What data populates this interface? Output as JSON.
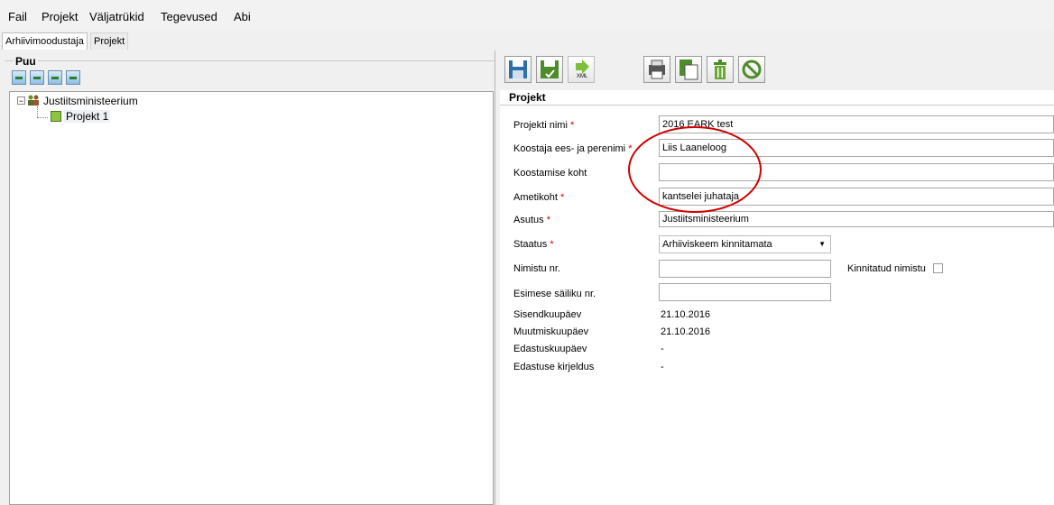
{
  "menu": {
    "items": [
      "Fail",
      "Projekt",
      "Väljatrükid",
      "Tegevused",
      "Abi"
    ]
  },
  "tabs": [
    {
      "label": "Arhiivimoodustaja",
      "active": true
    },
    {
      "label": "Projekt",
      "active": false
    }
  ],
  "left": {
    "title": "Puu",
    "tree": {
      "root": "Justiitsministeerium",
      "child": "Projekt 1"
    }
  },
  "right": {
    "section_title": "Projekt",
    "fields": {
      "projekti_nimi": {
        "label": "Projekti nimi",
        "value": "2016 EARK test"
      },
      "koostaja": {
        "label": "Koostaja ees- ja perenimi",
        "value": "Liis Laaneloog"
      },
      "koostamise_koht": {
        "label": "Koostamise koht",
        "value": ""
      },
      "ametikoht": {
        "label": "Ametikoht",
        "value": "kantselei juhataja"
      },
      "asutus": {
        "label": "Asutus",
        "value": "Justiitsministeerium"
      },
      "staatus": {
        "label": "Staatus",
        "value": "Arhiiviskeem kinnitamata"
      },
      "nimistu": {
        "label": "Nimistu nr.",
        "value": ""
      },
      "kinnitatud": {
        "label": "Kinnitatud nimistu",
        "checked": false
      },
      "esimese": {
        "label": "Esimese säiliku nr.",
        "value": ""
      },
      "sisend": {
        "label": "Sisendkuupäev",
        "value": "21.10.2016"
      },
      "muutmis": {
        "label": "Muutmiskuupäev",
        "value": "21.10.2016"
      },
      "edastus": {
        "label": "Edastuskuupäev",
        "value": "-"
      },
      "edastuse_kirjeldus": {
        "label": "Edastuse kirjeldus",
        "value": "-"
      }
    },
    "required_mark": "*",
    "xml_label": "XML"
  },
  "colors": {
    "required": "#d00000",
    "annotation_circle": "#d00000"
  }
}
